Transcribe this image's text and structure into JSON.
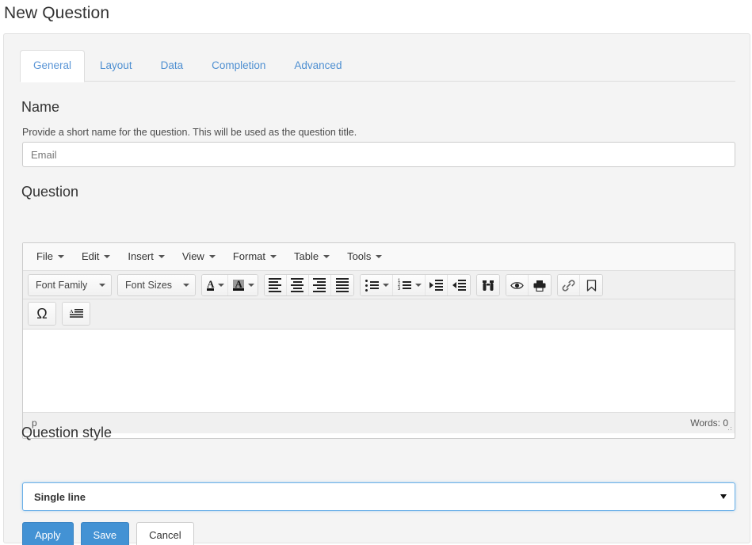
{
  "page": {
    "title": "New Question"
  },
  "tabs": [
    {
      "label": "General",
      "active": true
    },
    {
      "label": "Layout",
      "active": false
    },
    {
      "label": "Data",
      "active": false
    },
    {
      "label": "Completion",
      "active": false
    },
    {
      "label": "Advanced",
      "active": false
    }
  ],
  "name_section": {
    "heading": "Name",
    "help": "Provide a short name for the question. This will be used as the question title.",
    "value": "",
    "placeholder": "Email"
  },
  "question_section": {
    "heading": "Question",
    "editor": {
      "menubar": [
        "File",
        "Edit",
        "Insert",
        "View",
        "Format",
        "Table",
        "Tools"
      ],
      "toolbar_row1": {
        "font_family_label": "Font Family",
        "font_sizes_label": "Font Sizes",
        "icons": [
          "text-color-icon",
          "background-color-icon",
          "align-left-icon",
          "align-center-icon",
          "align-right-icon",
          "align-justify-icon",
          "bullet-list-icon",
          "numbered-list-icon",
          "indent-icon",
          "outdent-icon",
          "search-replace-icon",
          "preview-icon",
          "print-icon",
          "insert-link-icon",
          "anchor-icon"
        ]
      },
      "toolbar_row2": {
        "icons": [
          "special-character-icon",
          "insert-template-icon"
        ]
      },
      "content": "",
      "statusbar": {
        "path": "p",
        "words": "Words: 0"
      }
    }
  },
  "style_section": {
    "heading": "Question style",
    "selected": "Single line",
    "options": [
      "Single line"
    ]
  },
  "actions": {
    "apply": "Apply",
    "save": "Save",
    "cancel": "Cancel"
  },
  "colors": {
    "primary": "#4392d4",
    "link": "#4e8fd1",
    "panel_bg": "#f4f4f4",
    "focus_border": "#6bb0e8"
  }
}
